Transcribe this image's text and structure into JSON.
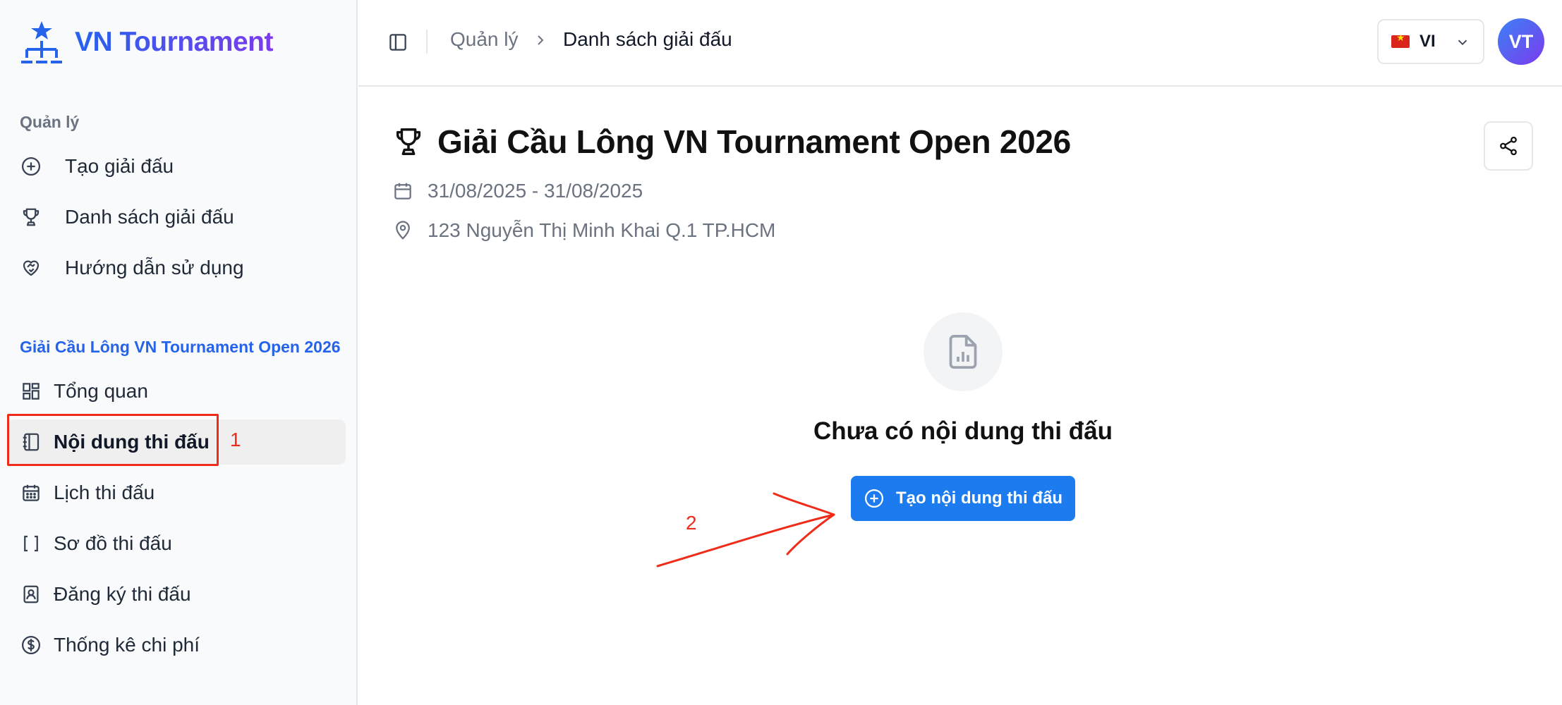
{
  "app": {
    "name": "VN Tournament"
  },
  "sidebar": {
    "section_manage": "Quản lý",
    "top_items": [
      {
        "label": "Tạo giải đấu",
        "icon": "plus-circle-icon"
      },
      {
        "label": "Danh sách giải đấu",
        "icon": "trophy-icon"
      },
      {
        "label": "Hướng dẫn sử dụng",
        "icon": "heart-handshake-icon"
      }
    ],
    "section_tournament": "Giải Cầu Lông VN Tournament Open 2026",
    "sub_items": [
      {
        "label": "Tổng quan",
        "icon": "dashboard-grid-icon"
      },
      {
        "label": "Nội dung thi đấu",
        "icon": "notebook-icon",
        "active": true
      },
      {
        "label": "Lịch thi đấu",
        "icon": "calendar-icon"
      },
      {
        "label": "Sơ đồ thi đấu",
        "icon": "brackets-icon"
      },
      {
        "label": "Đăng ký thi đấu",
        "icon": "contact-book-icon"
      },
      {
        "label": "Thống kê chi phí",
        "icon": "dollar-circle-icon"
      }
    ]
  },
  "header": {
    "breadcrumb": [
      "Quản lý",
      "Danh sách giải đấu"
    ],
    "language": "VI",
    "avatar_initials": "VT"
  },
  "tournament": {
    "title": "Giải Cầu Lông VN Tournament Open 2026",
    "dates": "31/08/2025 - 31/08/2025",
    "location": "123 Nguyễn Thị Minh Khai Q.1 TP.HCM"
  },
  "empty_state": {
    "message": "Chưa có nội dung thi đấu",
    "button_label": "Tạo nội dung thi đấu"
  },
  "annotations": {
    "step1": "1",
    "step2": "2",
    "color": "#ef2b1a"
  },
  "colors": {
    "primary": "#1d7bf0",
    "brand_gradient_start": "#2563eb",
    "brand_gradient_end": "#7c3aed"
  }
}
